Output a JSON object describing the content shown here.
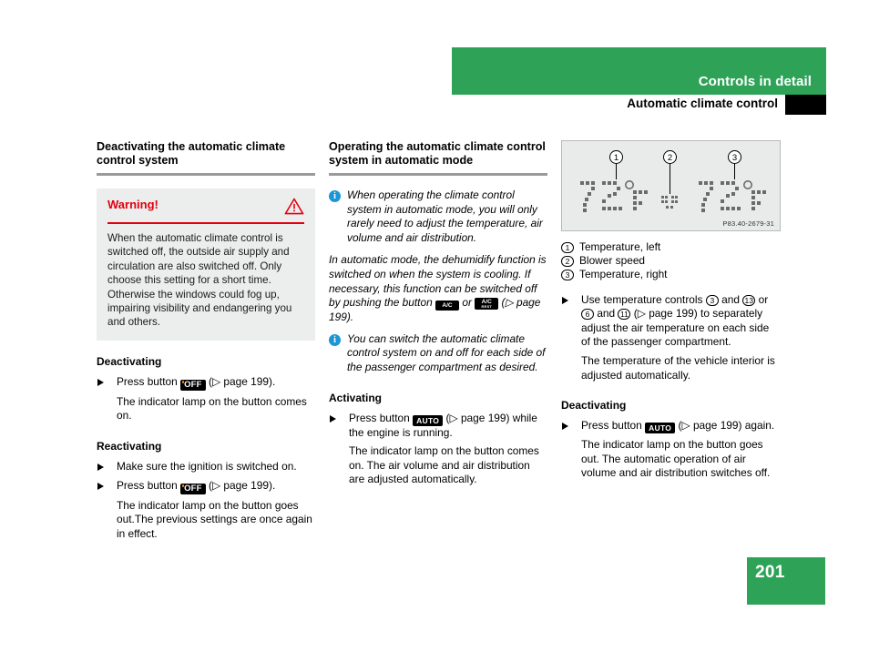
{
  "header": {
    "chapter": "Controls in detail",
    "section": "Automatic climate control"
  },
  "page_number": "201",
  "left_column": {
    "title": "Deactivating the automatic climate control system",
    "warning": {
      "title": "Warning!",
      "icon": "warning-triangle-icon",
      "body": "When the automatic climate control is switched off, the outside air supply and circulation are also switched off. Only choose this setting for a short time. Otherwise the windows could fog up, impairing visibility and endangering you and others."
    },
    "deactivating": {
      "heading": "Deactivating",
      "step_pre": "Press button",
      "button": "OFF",
      "step_post": "(▷ page 199).",
      "result": "The indicator lamp on the button comes on."
    },
    "reactivating": {
      "heading": "Reactivating",
      "step1": "Make sure the ignition is switched on.",
      "step2_pre": "Press button",
      "button": "OFF",
      "step2_post": "(▷ page 199).",
      "result": "The indicator lamp on the button goes out.The previous settings are once again in effect."
    }
  },
  "mid_column": {
    "title": "Operating the automatic climate control system in automatic mode",
    "note1": "When operating the climate control system in automatic mode, you will only rarely need to adjust the temperature, air volume and air distribution.",
    "para1_pre": "In automatic mode, the dehumidify function is switched on when the system is cooling. If necessary, this function can be switched off by pushing the button",
    "button_ac": "A/C",
    "para1_or": "or",
    "button_ac_rest": "A/C",
    "button_ac_rest_sub": "REST",
    "para1_post": "(▷ page 199).",
    "note2": "You can switch the automatic climate control system on and off for each side of the passenger compartment as desired.",
    "activating": {
      "heading": "Activating",
      "step_pre": "Press button",
      "button": "AUTO",
      "step_post": "(▷ page 199) while the engine is running.",
      "result": "The indicator lamp on the button comes on. The air volume and air distribution are adjusted automatically."
    }
  },
  "right_column": {
    "figure": {
      "caption": "P83.40-2679-31",
      "callouts": [
        "1",
        "2",
        "3"
      ],
      "display_left": "72°F",
      "display_right": "72°F",
      "display_center": "blower-bars"
    },
    "legend": [
      {
        "num": "1",
        "label": "Temperature, left"
      },
      {
        "num": "2",
        "label": "Blower speed"
      },
      {
        "num": "3",
        "label": "Temperature, right"
      }
    ],
    "step": {
      "pre": "Use temperature controls",
      "n1": "3",
      "mid1": "and",
      "n2": "13",
      "mid2": "or",
      "n3": "6",
      "mid3": "and",
      "n4": "11",
      "post": "(▷ page 199) to separately adjust the air temperature on each side of the passenger compartment.",
      "result": "The temperature of the vehicle interior is adjusted automatically."
    },
    "deactivating": {
      "heading": "Deactivating",
      "step_pre": "Press button",
      "button": "AUTO",
      "step_post": "(▷ page 199) again.",
      "result": "The indicator lamp on the button goes out. The automatic operation of air volume and air distribution switches off."
    }
  },
  "colors": {
    "brand_green": "#2ea358",
    "warning_red": "#e3000f",
    "info_blue": "#1b97d5",
    "indicator_orange": "#ff8a00",
    "warn_box_bg": "#eceded",
    "figure_bg": "#e9eaea"
  }
}
